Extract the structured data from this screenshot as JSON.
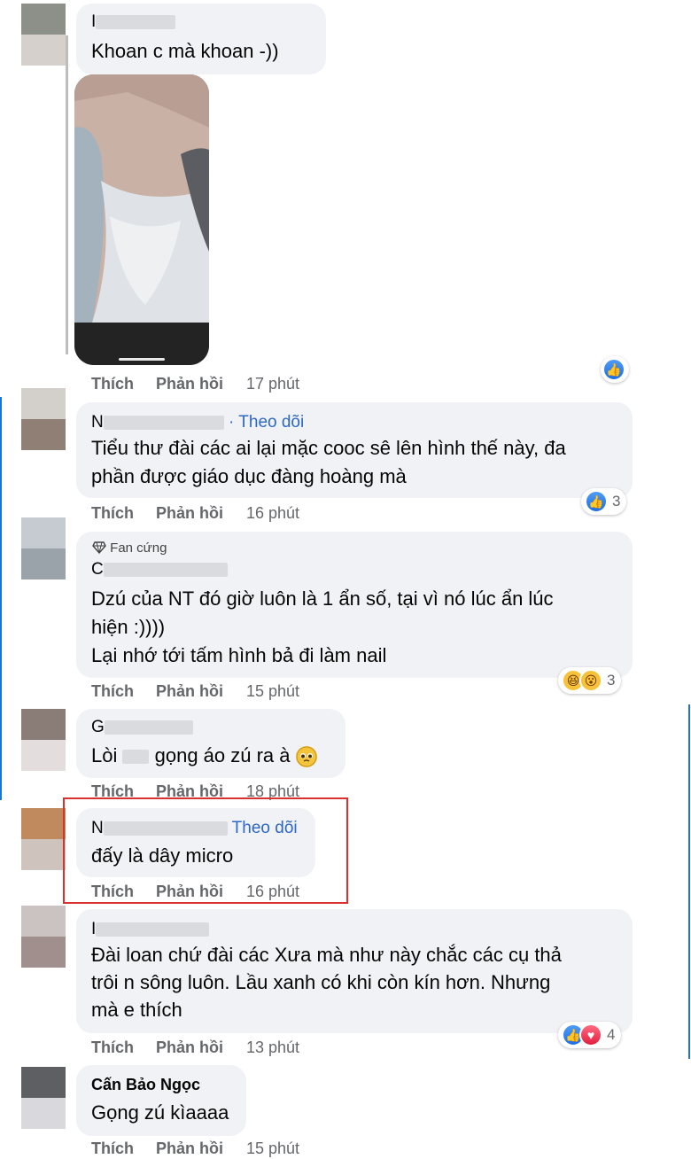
{
  "comments": [
    {
      "name_prefix": "I",
      "text_lines": [
        "Khoan c     mà khoan -))"
      ],
      "actions": {
        "like": "Thích",
        "reply": "Phản hồi",
        "time": "17 phút"
      }
    },
    {
      "name_prefix": "N",
      "follow": "· Theo dõi",
      "text_lines": [
        "Tiểu thư đài các ai lại mặc cooc sê lên hình thế này, đa",
        "phần được giáo dục đàng hoàng mà"
      ],
      "actions": {
        "like": "Thích",
        "reply": "Phản hồi",
        "time": "16 phút"
      },
      "reaction_count": "3"
    },
    {
      "badge": "Fan cứng",
      "name_prefix": "C",
      "text_lines": [
        "Dzú của NT đó giờ luôn là 1 ẩn số, tại vì nó lúc ẩn lúc",
        "hiện :))))",
        "Lại nhớ tới tấm hình bả đi làm nail"
      ],
      "actions": {
        "like": "Thích",
        "reply": "Phản hồi",
        "time": "15 phút"
      },
      "reaction_count": "3"
    },
    {
      "name_prefix": "G",
      "text_before": "Lòi",
      "text_after": "gọng áo zú ra à",
      "actions": {
        "like": "Thích",
        "reply": "Phản hồi",
        "time": "18 phút"
      }
    },
    {
      "name_prefix": "N",
      "follow": "Theo dõi",
      "text_lines": [
        "đấy là dây micro"
      ],
      "actions": {
        "like": "Thích",
        "reply": "Phản hồi",
        "time": "16 phút"
      }
    },
    {
      "name_prefix": "I",
      "text_lines": [
        "Đài loan chứ đài các      Xưa mà như này chắc các cụ thả",
        "trôi n     sông luôn. Lầu xanh có khi còn kín hơn. Nhưng",
        "mà e thích"
      ],
      "actions": {
        "like": "Thích",
        "reply": "Phản hồi",
        "time": "13 phút"
      },
      "reaction_count": "4"
    },
    {
      "name": "Cấn Bảo Ngọc",
      "text_lines": [
        "Gọng zú kìaaaa"
      ],
      "actions": {
        "like": "Thích",
        "reply": "Phản hồi",
        "time": "15 phút"
      }
    }
  ],
  "icons": {
    "like": "thumbs-up-icon",
    "love": "heart-icon",
    "haha": "laughing-face-icon",
    "wow": "surprised-face-icon",
    "pleading": "pleading-face-icon",
    "fan": "diamond-icon"
  },
  "colors": {
    "bubble": "#f0f2f5",
    "follow": "#2d68c4",
    "like": "#1b6ee5",
    "highlight": "#d93030"
  }
}
